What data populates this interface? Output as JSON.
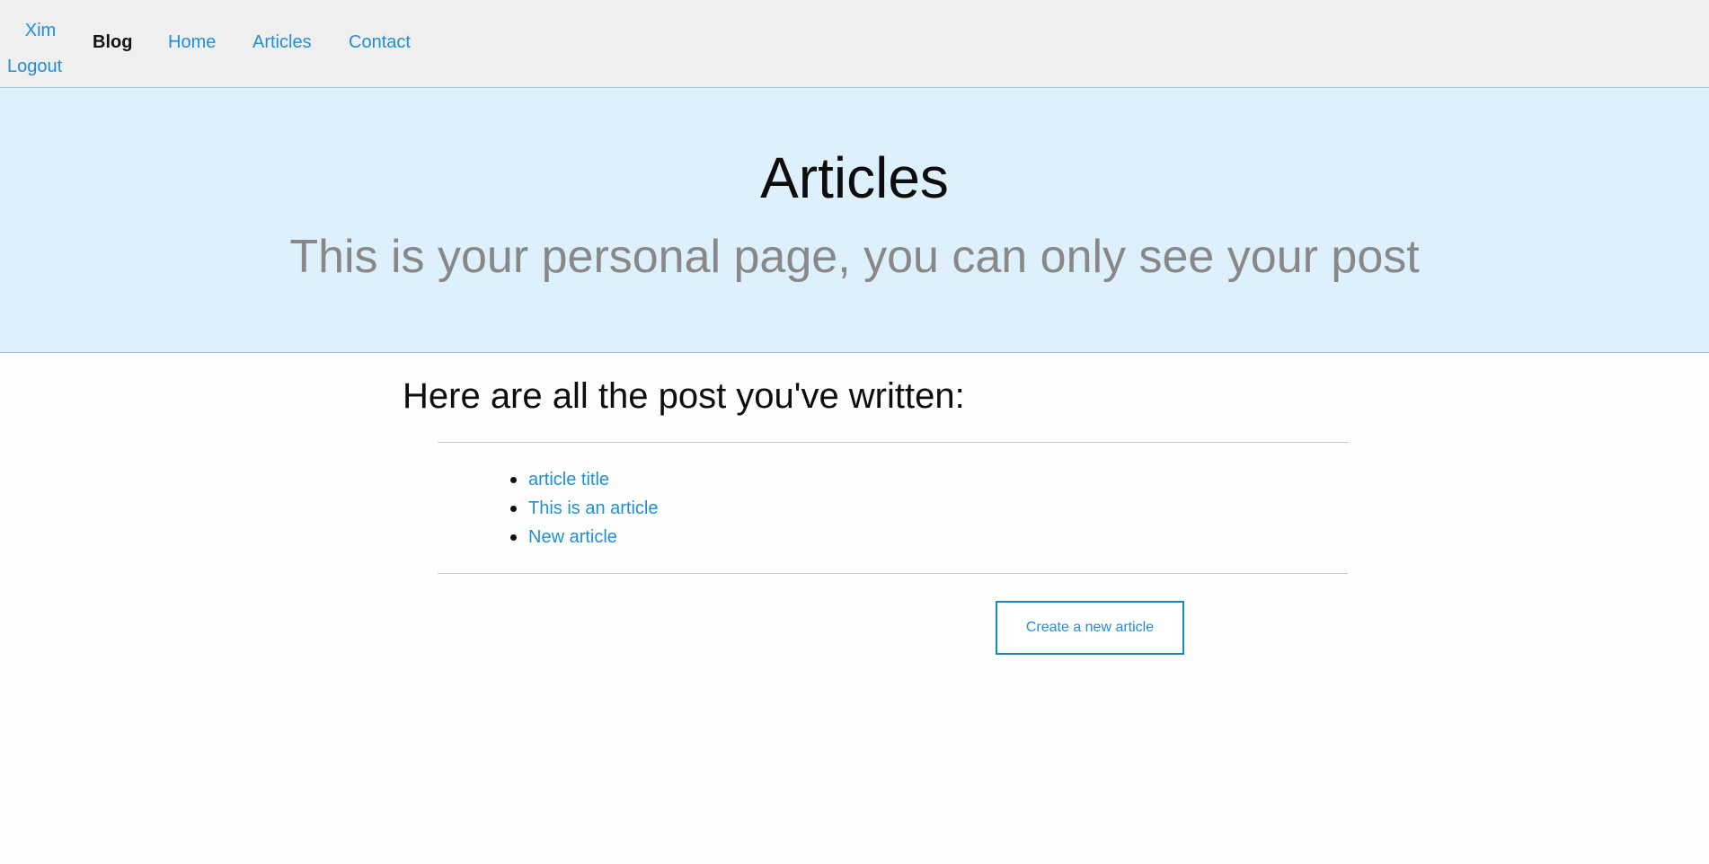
{
  "header": {
    "user_name": "Xim",
    "logout_label": "Logout",
    "brand": "Blog",
    "nav": {
      "home": "Home",
      "articles": "Articles",
      "contact": "Contact"
    }
  },
  "hero": {
    "title": "Articles",
    "subtitle": "This is your personal page, you can only see your post"
  },
  "main": {
    "heading": "Here are all the post you've written:",
    "posts": [
      {
        "title": "article title"
      },
      {
        "title": "This is an article"
      },
      {
        "title": "New article"
      }
    ],
    "create_button_label": "Create a new article"
  },
  "colors": {
    "link": "#1f8fd6",
    "header_bg": "#efefef",
    "hero_bg": "#def0fb",
    "subtitle": "#888888",
    "button_border": "#1a86bd"
  }
}
